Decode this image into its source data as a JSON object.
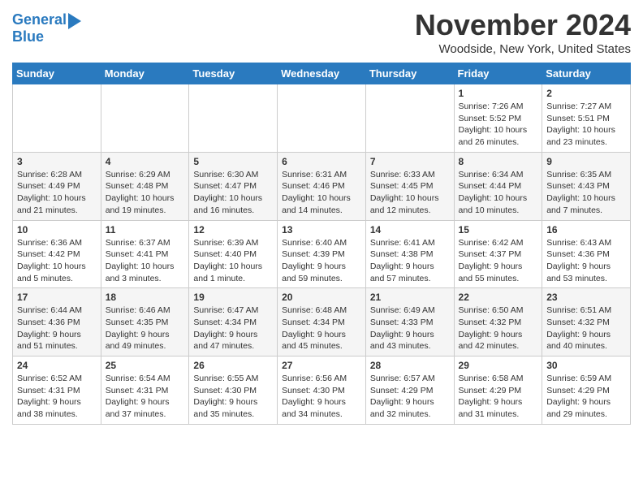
{
  "logo": {
    "line1": "General",
    "line2": "Blue"
  },
  "title": "November 2024",
  "location": "Woodside, New York, United States",
  "weekdays": [
    "Sunday",
    "Monday",
    "Tuesday",
    "Wednesday",
    "Thursday",
    "Friday",
    "Saturday"
  ],
  "weeks": [
    [
      {
        "day": "",
        "info": ""
      },
      {
        "day": "",
        "info": ""
      },
      {
        "day": "",
        "info": ""
      },
      {
        "day": "",
        "info": ""
      },
      {
        "day": "",
        "info": ""
      },
      {
        "day": "1",
        "info": "Sunrise: 7:26 AM\nSunset: 5:52 PM\nDaylight: 10 hours\nand 26 minutes."
      },
      {
        "day": "2",
        "info": "Sunrise: 7:27 AM\nSunset: 5:51 PM\nDaylight: 10 hours\nand 23 minutes."
      }
    ],
    [
      {
        "day": "3",
        "info": "Sunrise: 6:28 AM\nSunset: 4:49 PM\nDaylight: 10 hours\nand 21 minutes."
      },
      {
        "day": "4",
        "info": "Sunrise: 6:29 AM\nSunset: 4:48 PM\nDaylight: 10 hours\nand 19 minutes."
      },
      {
        "day": "5",
        "info": "Sunrise: 6:30 AM\nSunset: 4:47 PM\nDaylight: 10 hours\nand 16 minutes."
      },
      {
        "day": "6",
        "info": "Sunrise: 6:31 AM\nSunset: 4:46 PM\nDaylight: 10 hours\nand 14 minutes."
      },
      {
        "day": "7",
        "info": "Sunrise: 6:33 AM\nSunset: 4:45 PM\nDaylight: 10 hours\nand 12 minutes."
      },
      {
        "day": "8",
        "info": "Sunrise: 6:34 AM\nSunset: 4:44 PM\nDaylight: 10 hours\nand 10 minutes."
      },
      {
        "day": "9",
        "info": "Sunrise: 6:35 AM\nSunset: 4:43 PM\nDaylight: 10 hours\nand 7 minutes."
      }
    ],
    [
      {
        "day": "10",
        "info": "Sunrise: 6:36 AM\nSunset: 4:42 PM\nDaylight: 10 hours\nand 5 minutes."
      },
      {
        "day": "11",
        "info": "Sunrise: 6:37 AM\nSunset: 4:41 PM\nDaylight: 10 hours\nand 3 minutes."
      },
      {
        "day": "12",
        "info": "Sunrise: 6:39 AM\nSunset: 4:40 PM\nDaylight: 10 hours\nand 1 minute."
      },
      {
        "day": "13",
        "info": "Sunrise: 6:40 AM\nSunset: 4:39 PM\nDaylight: 9 hours\nand 59 minutes."
      },
      {
        "day": "14",
        "info": "Sunrise: 6:41 AM\nSunset: 4:38 PM\nDaylight: 9 hours\nand 57 minutes."
      },
      {
        "day": "15",
        "info": "Sunrise: 6:42 AM\nSunset: 4:37 PM\nDaylight: 9 hours\nand 55 minutes."
      },
      {
        "day": "16",
        "info": "Sunrise: 6:43 AM\nSunset: 4:36 PM\nDaylight: 9 hours\nand 53 minutes."
      }
    ],
    [
      {
        "day": "17",
        "info": "Sunrise: 6:44 AM\nSunset: 4:36 PM\nDaylight: 9 hours\nand 51 minutes."
      },
      {
        "day": "18",
        "info": "Sunrise: 6:46 AM\nSunset: 4:35 PM\nDaylight: 9 hours\nand 49 minutes."
      },
      {
        "day": "19",
        "info": "Sunrise: 6:47 AM\nSunset: 4:34 PM\nDaylight: 9 hours\nand 47 minutes."
      },
      {
        "day": "20",
        "info": "Sunrise: 6:48 AM\nSunset: 4:34 PM\nDaylight: 9 hours\nand 45 minutes."
      },
      {
        "day": "21",
        "info": "Sunrise: 6:49 AM\nSunset: 4:33 PM\nDaylight: 9 hours\nand 43 minutes."
      },
      {
        "day": "22",
        "info": "Sunrise: 6:50 AM\nSunset: 4:32 PM\nDaylight: 9 hours\nand 42 minutes."
      },
      {
        "day": "23",
        "info": "Sunrise: 6:51 AM\nSunset: 4:32 PM\nDaylight: 9 hours\nand 40 minutes."
      }
    ],
    [
      {
        "day": "24",
        "info": "Sunrise: 6:52 AM\nSunset: 4:31 PM\nDaylight: 9 hours\nand 38 minutes."
      },
      {
        "day": "25",
        "info": "Sunrise: 6:54 AM\nSunset: 4:31 PM\nDaylight: 9 hours\nand 37 minutes."
      },
      {
        "day": "26",
        "info": "Sunrise: 6:55 AM\nSunset: 4:30 PM\nDaylight: 9 hours\nand 35 minutes."
      },
      {
        "day": "27",
        "info": "Sunrise: 6:56 AM\nSunset: 4:30 PM\nDaylight: 9 hours\nand 34 minutes."
      },
      {
        "day": "28",
        "info": "Sunrise: 6:57 AM\nSunset: 4:29 PM\nDaylight: 9 hours\nand 32 minutes."
      },
      {
        "day": "29",
        "info": "Sunrise: 6:58 AM\nSunset: 4:29 PM\nDaylight: 9 hours\nand 31 minutes."
      },
      {
        "day": "30",
        "info": "Sunrise: 6:59 AM\nSunset: 4:29 PM\nDaylight: 9 hours\nand 29 minutes."
      }
    ]
  ]
}
